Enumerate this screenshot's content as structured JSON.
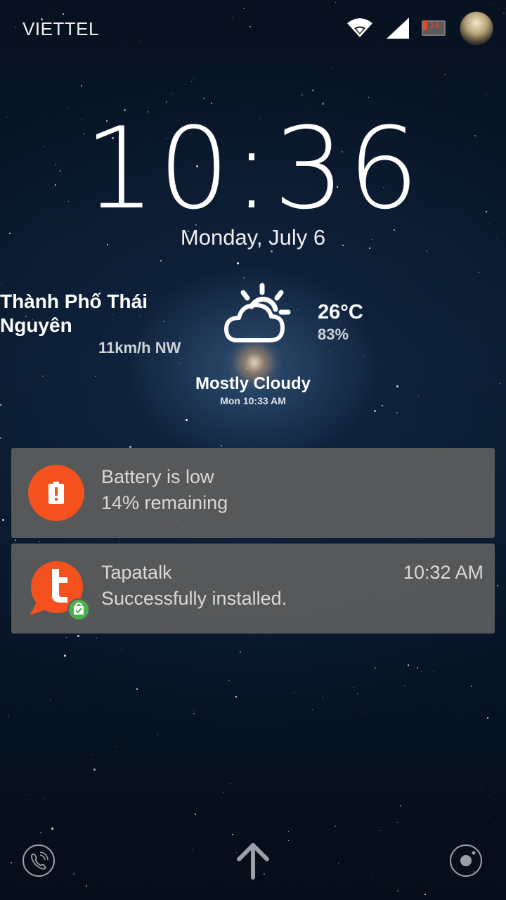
{
  "status_bar": {
    "carrier": "VIETTEL",
    "battery_level": "14",
    "icons": [
      "wifi-icon",
      "signal-icon",
      "battery-icon",
      "avatar"
    ]
  },
  "clock": {
    "time": "10:36",
    "date": "Monday, July 6"
  },
  "weather": {
    "city": "Thành Phố Thái Nguyên",
    "wind": "11km/h NW",
    "temperature": "26°C",
    "humidity": "83%",
    "condition": "Mostly Cloudy",
    "updated": "Mon 10:33 AM",
    "icon": "partly-cloudy-icon"
  },
  "notifications": [
    {
      "app_icon": "battery-alert-icon",
      "title": "Battery is low",
      "text": "14% remaining",
      "time": ""
    },
    {
      "app_icon": "tapatalk-icon",
      "title": "Tapatalk",
      "text": "Successfully installed.",
      "time": "10:32 AM"
    }
  ],
  "bottom_bar": {
    "left": "phone-icon",
    "center": "unlock-arrow-icon",
    "right": "camera-icon"
  },
  "colors": {
    "accent_orange": "#f4511e",
    "badge_green": "#4caf50",
    "notification_bg": "#5c5c5c"
  }
}
